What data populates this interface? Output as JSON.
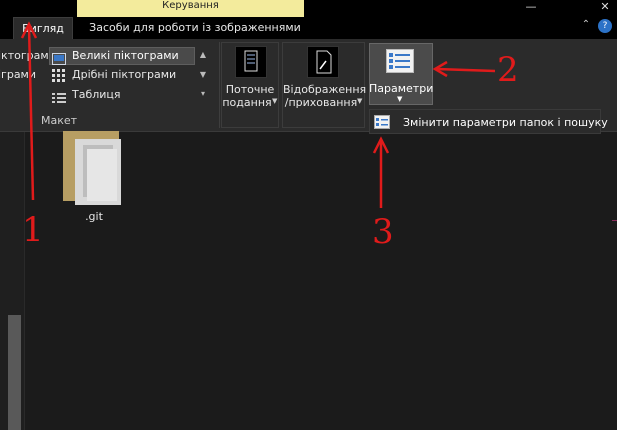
{
  "window": {
    "context_tab": "Керування",
    "tabs": [
      "Вигляд",
      "Засоби для роботи із зображеннями"
    ],
    "controls": {
      "minimize": "—",
      "close": "✕",
      "collapse_ribbon": "⌃",
      "help": "?"
    }
  },
  "ribbon": {
    "layout_items_left": [
      "іктограми",
      "іграми"
    ],
    "layout_items": [
      "Великі піктограми",
      "Дрібні піктограми",
      "Таблиця"
    ],
    "layout_group_label": "Макет",
    "current_view": [
      "Поточне",
      "подання"
    ],
    "show_hide": [
      "Відображення",
      "/приховання"
    ],
    "options_label": "Параметри"
  },
  "dropdown": {
    "item_label": "Змінити параметри папок і пошуку"
  },
  "content": {
    "items": [
      {
        "name": ".git",
        "type": "folder"
      }
    ]
  },
  "annotations": {
    "arrow_color": "#e01b1b",
    "labels": [
      "1",
      "2",
      "3"
    ]
  },
  "colors": {
    "context_tab": "#f3eb9c",
    "background": "#1b1b1b",
    "ribbon": "#2b2b2b"
  }
}
